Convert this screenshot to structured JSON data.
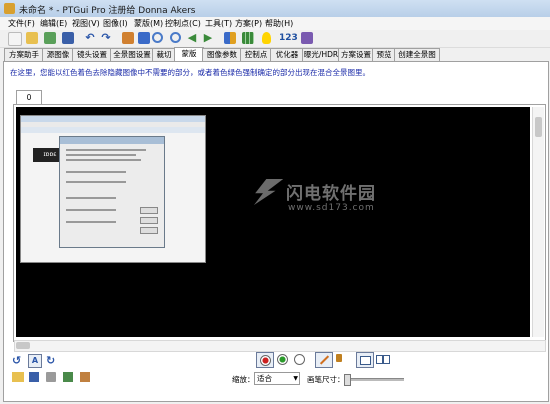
{
  "window": {
    "title": "未命名 * - PTGui Pro 注册给 Donna Akers"
  },
  "menu": [
    "文件(F)",
    "编辑(E)",
    "视图(V)",
    "图像(I)",
    "蒙版(M)",
    "控制点(C)",
    "工具(T)",
    "方案(P)",
    "帮助(H)"
  ],
  "toolbar": {
    "counter_label": "123"
  },
  "tabs": [
    "方案助手",
    "源图像",
    "镜头设置",
    "全景图设置",
    "裁切",
    "蒙版",
    "图像参数",
    "控制点",
    "优化器",
    "曝光/HDR",
    "方案设置",
    "预览",
    "创建全景图"
  ],
  "active_tab": "蒙版",
  "hint": "在这里，您能以红色着色去除隐藏图像中不需要的部分，或者着色绿色强制确定的部分出现在混合全景图里。",
  "image_tab": "0",
  "embedded": {
    "thumb_text": "ɪɒɒɛ"
  },
  "watermark": {
    "name": "闪电软件园",
    "url": "www.sd173.com"
  },
  "bottom": {
    "zoom_label": "缩放：",
    "zoom_value": "适合",
    "brush_label": "画笔尺寸："
  },
  "icons": {
    "app": "app-icon",
    "undo": "undo-icon",
    "redo": "redo-icon",
    "folder": "folder-icon",
    "save": "save-icon"
  },
  "colors": {
    "canvas": "#000000",
    "hint": "#1a2aa8",
    "accent_red": "#cc2020",
    "accent_green": "#2a9a2a"
  }
}
